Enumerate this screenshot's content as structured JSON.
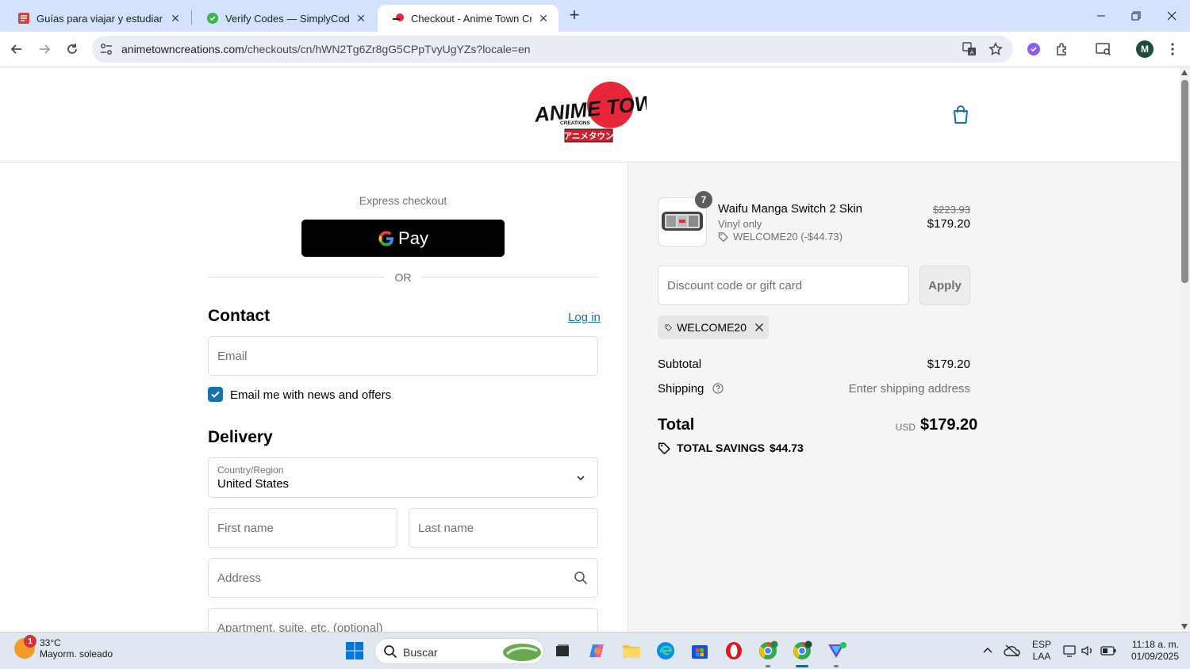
{
  "browser": {
    "tabs": [
      {
        "title": "Guías para viajar y estudiar en M",
        "active": false
      },
      {
        "title": "Verify Codes — SimplyCodes",
        "active": false
      },
      {
        "title": "Checkout - Anime Town Creatio",
        "active": true
      }
    ],
    "url_host": "animetowncreations.com",
    "url_path": "/checkouts/cn/hWN2Tg6Zr8gG5CPpTvyUgYZs?locale=en",
    "profile_initial": "M"
  },
  "shop": {
    "logo_main": "ANIME TOWN",
    "logo_sub": "CREATIONS",
    "logo_jp": "アニメタウン"
  },
  "checkout": {
    "express_title": "Express checkout",
    "gpay_label": "Pay",
    "or_label": "OR",
    "contact_heading": "Contact",
    "login_link": "Log in",
    "email_placeholder": "Email",
    "newsletter_label": "Email me with news and offers",
    "newsletter_checked": true,
    "delivery_heading": "Delivery",
    "country_label": "Country/Region",
    "country_value": "United States",
    "first_name_placeholder": "First name",
    "last_name_placeholder": "Last name",
    "address_placeholder": "Address",
    "apartment_placeholder": "Apartment, suite, etc. (optional)"
  },
  "summary": {
    "item": {
      "name": "Waifu Manga Switch 2 Skin",
      "variant": "Vinyl only",
      "discount": "WELCOME20 (-$44.73)",
      "quantity": "7",
      "original_price": "$223.93",
      "price": "$179.20"
    },
    "discount_placeholder": "Discount code or gift card",
    "apply_label": "Apply",
    "applied_code": "WELCOME20",
    "subtotal_label": "Subtotal",
    "subtotal_value": "$179.20",
    "shipping_label": "Shipping",
    "shipping_value": "Enter shipping address",
    "total_label": "Total",
    "total_currency": "USD",
    "total_value": "$179.20",
    "savings_label": "TOTAL SAVINGS",
    "savings_value": "$44.73"
  },
  "taskbar": {
    "weather_badge": "1",
    "temperature": "33°C",
    "weather_desc": "Mayorm. soleado",
    "search_label": "Buscar",
    "lang_top": "ESP",
    "lang_bottom": "LAA",
    "time": "11:18 a. m.",
    "date": "01/09/2025"
  },
  "colors": {
    "tabstrip": "#d3e3fd",
    "link": "#1773b0",
    "checkbox": "#1773b0",
    "logo_red": "#e8263a"
  }
}
